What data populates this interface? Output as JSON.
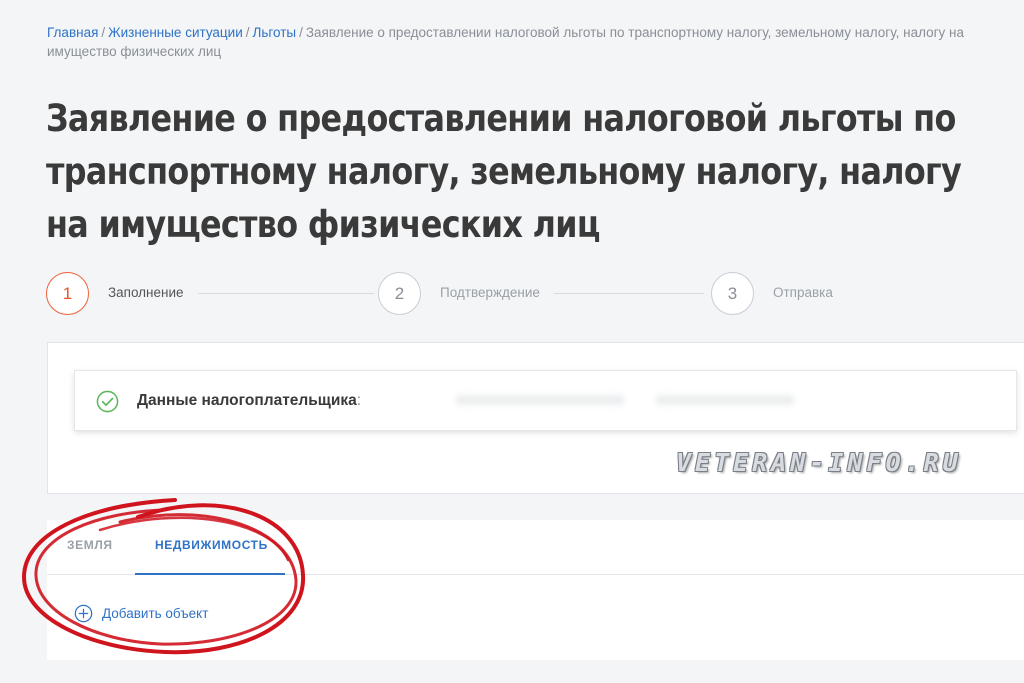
{
  "breadcrumb": {
    "items": [
      "Главная",
      "Жизненные ситуации",
      "Льготы"
    ],
    "current": "Заявление о предоставлении налоговой льготы по транспортному налогу, земельному налогу, налогу на имущество физических лиц"
  },
  "page_title": "Заявление о предоставлении налоговой льготы по транспортному налогу, земельному налогу, налогу на имущество физических лиц",
  "steps": [
    {
      "number": "1",
      "label": "Заполнение",
      "active": true
    },
    {
      "number": "2",
      "label": "Подтверждение",
      "active": false
    },
    {
      "number": "3",
      "label": "Отправка",
      "active": false
    }
  ],
  "taxpayer": {
    "label": "Данные налогоплательщика",
    "colon": ":"
  },
  "watermark": "VETERAN-INFO.RU",
  "tabs": [
    {
      "label": "ЗЕМЛЯ",
      "active": false
    },
    {
      "label": "НЕДВИЖИМОСТЬ",
      "active": true
    }
  ],
  "add_object_label": "Добавить объект",
  "colors": {
    "accent": "#2f72c6",
    "step_active": "#f0603a",
    "annotation": "#d0141e",
    "success": "#5cb85c"
  }
}
